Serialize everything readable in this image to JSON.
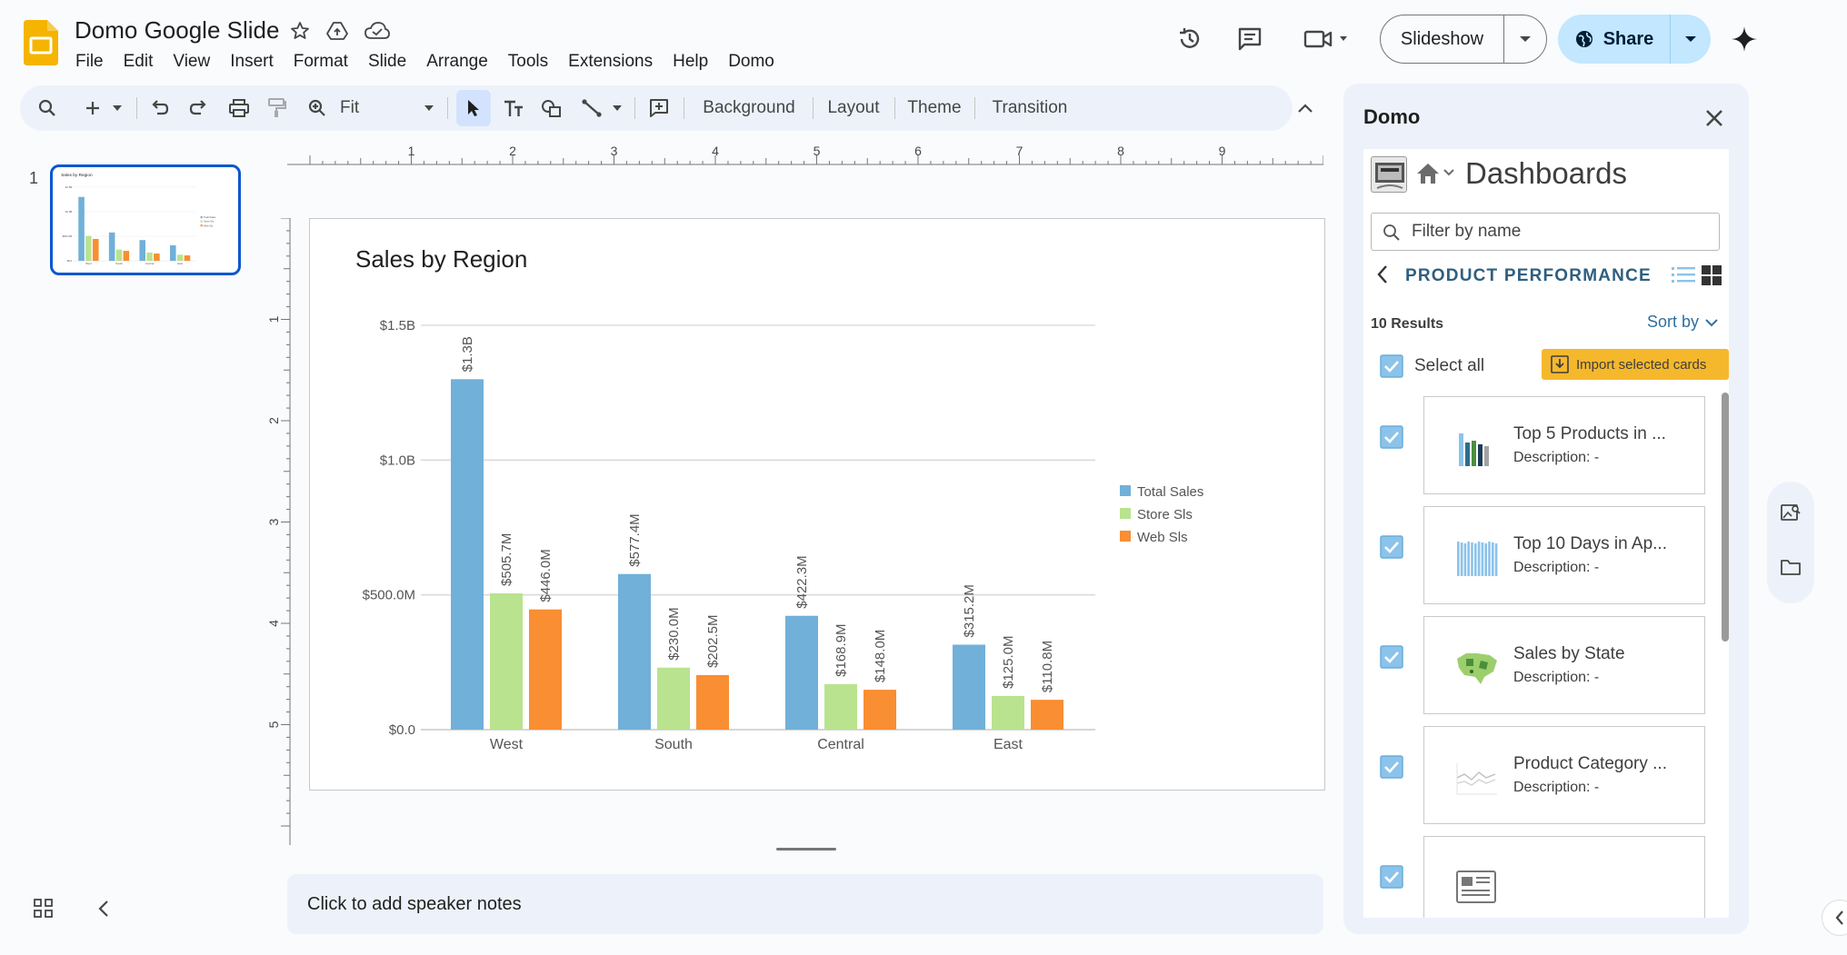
{
  "app": {
    "doc_title": "Domo Google Slide",
    "menu": [
      "File",
      "Edit",
      "View",
      "Insert",
      "Format",
      "Slide",
      "Arrange",
      "Tools",
      "Extensions",
      "Help",
      "Domo"
    ],
    "slideshow_label": "Slideshow",
    "share_label": "Share",
    "brand_color": "#f4b400"
  },
  "toolbar": {
    "zoom_label": "Fit",
    "background_label": "Background",
    "layout_label": "Layout",
    "theme_label": "Theme",
    "transition_label": "Transition"
  },
  "filmstrip": {
    "slide_number": "1"
  },
  "ruler": {
    "top_labels": [
      "1",
      "2",
      "3",
      "4",
      "5",
      "6",
      "7",
      "8",
      "9"
    ],
    "left_labels": [
      "1",
      "2",
      "3",
      "4",
      "5"
    ]
  },
  "notes": {
    "placeholder": "Click to add speaker notes"
  },
  "chart_data": {
    "type": "bar",
    "title": "Sales by Region",
    "categories": [
      "West",
      "South",
      "Central",
      "East"
    ],
    "series": [
      {
        "name": "Total Sales",
        "color": "#71b0d9",
        "values": [
          1.3,
          0.5774,
          0.4223,
          0.3152
        ],
        "labels": [
          "$1.3B",
          "$577.4M",
          "$422.3M",
          "$315.2M"
        ]
      },
      {
        "name": "Store Sls",
        "color": "#b9e38e",
        "values": [
          0.5057,
          0.23,
          0.1689,
          0.125
        ],
        "labels": [
          "$505.7M",
          "$230.0M",
          "$168.9M",
          "$125.0M"
        ]
      },
      {
        "name": "Web Sls",
        "color": "#f98e32",
        "values": [
          0.446,
          0.2025,
          0.148,
          0.1108
        ],
        "labels": [
          "$446.0M",
          "$202.5M",
          "$148.0M",
          "$110.8M"
        ]
      }
    ],
    "y_ticks": [
      0,
      0.5,
      1.0,
      1.5
    ],
    "y_tick_labels": [
      "$0.0",
      "$500.0M",
      "$1.0B",
      "$1.5B"
    ],
    "ylim": [
      0,
      1.5
    ],
    "grid": true,
    "legend_position": "right"
  },
  "side_panel": {
    "title": "Domo",
    "dashboards_title": "Dashboards",
    "filter_placeholder": "Filter by name",
    "folder_name": "PRODUCT PERFORMANCE",
    "results_label": "10 Results",
    "sort_label": "Sort by",
    "select_all_label": "Select all",
    "import_label": "Import selected cards",
    "cards": [
      {
        "name": "Top 5 Products in ...",
        "description": "Description: -",
        "thumb": "bar-chart-thumb"
      },
      {
        "name": "Top 10 Days in Ap...",
        "description": "Description: -",
        "thumb": "column-chart-thumb"
      },
      {
        "name": "Sales by State",
        "description": "Description: -",
        "thumb": "map-thumb"
      },
      {
        "name": "Product Category ...",
        "description": "Description: -",
        "thumb": "line-chart-thumb"
      },
      {
        "name": "",
        "description": "",
        "thumb": "document-thumb"
      }
    ]
  }
}
